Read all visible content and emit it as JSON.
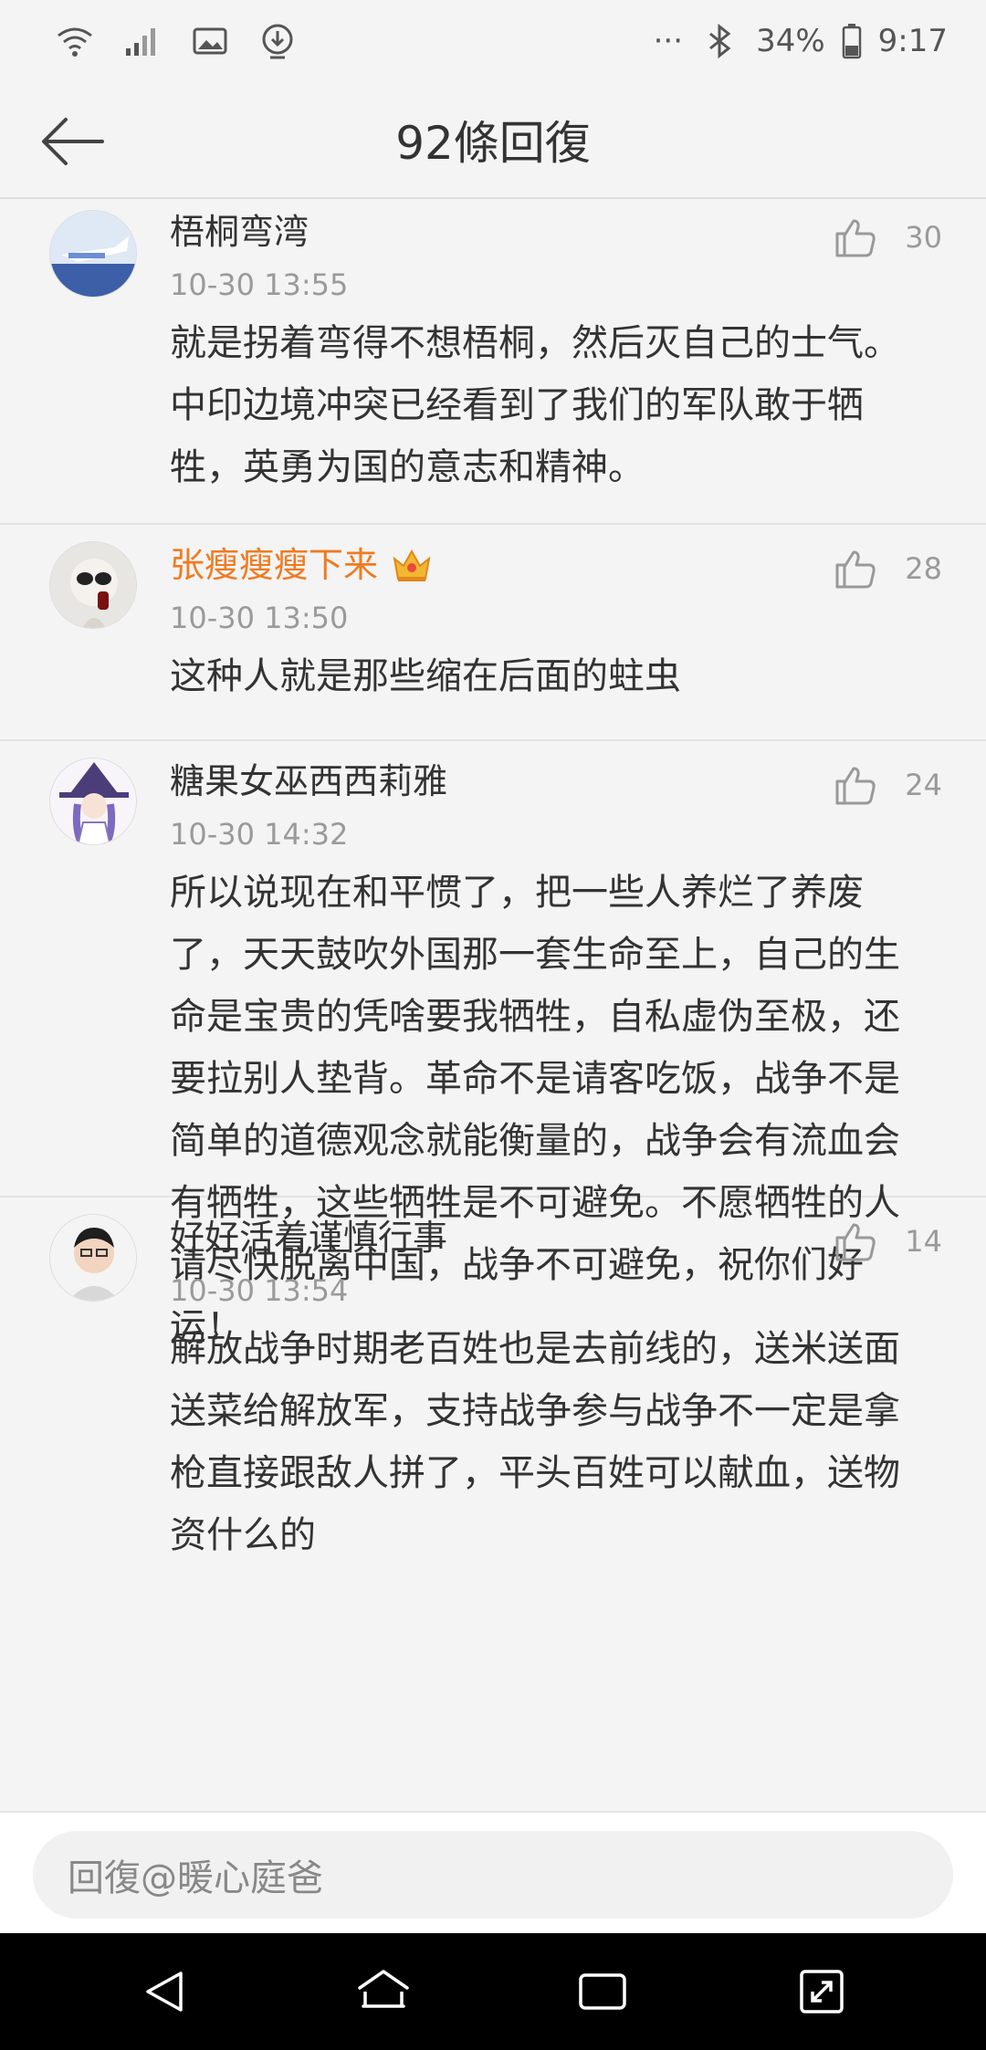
{
  "status_bar": {
    "battery": "34%",
    "time": "9:17",
    "more": "···",
    "icons": [
      "wifi-icon",
      "signal-icon",
      "image-icon",
      "download-icon",
      "bluetooth-icon",
      "battery-icon"
    ]
  },
  "header": {
    "title": "92條回復",
    "back_icon": "back-arrow-icon"
  },
  "comments": [
    {
      "name": "梧桐弯湾",
      "time": "10-30 13:55",
      "likes": "30",
      "text": "就是拐着弯得不想梧桐，然后灭自己的士气。中印边境冲突已经看到了我们的军队敢于牺牲，英勇为国的意志和精神。",
      "vip": false
    },
    {
      "name": "张瘦瘦瘦下来",
      "time": "10-30 13:50",
      "likes": "28",
      "text": "这种人就是那些缩在后面的蛀虫",
      "vip": true
    },
    {
      "name": "糖果女巫西西莉雅",
      "time": "10-30 14:32",
      "likes": "24",
      "text": "所以说现在和平惯了，把一些人养烂了养废了，天天鼓吹外国那一套生命至上，自己的生命是宝贵的凭啥要我牺牲，自私虚伪至极，还要拉别人垫背。革命不是请客吃饭，战争不是简单的道德观念就能衡量的，战争会有流血会有牺牲，这些牺牲是不可避免。不愿牺牲的人请尽快脱离中国，战争不可避免，祝你们好运！",
      "vip": false
    },
    {
      "name": "好好活着谨慎行事",
      "time": "10-30 13:54",
      "likes": "14",
      "text": "解放战争时期老百姓也是去前线的，送米送面送菜给解放军，支持战争参与战争不一定是拿枪直接跟敌人拼了，平头百姓可以献血，送物资什么的",
      "vip": false
    }
  ],
  "reply": {
    "placeholder": "回復@暖心庭爸"
  },
  "colors": {
    "vip_name": "#f07b22",
    "meta_gray": "#9a9a9a",
    "background": "#f4f4f4"
  }
}
